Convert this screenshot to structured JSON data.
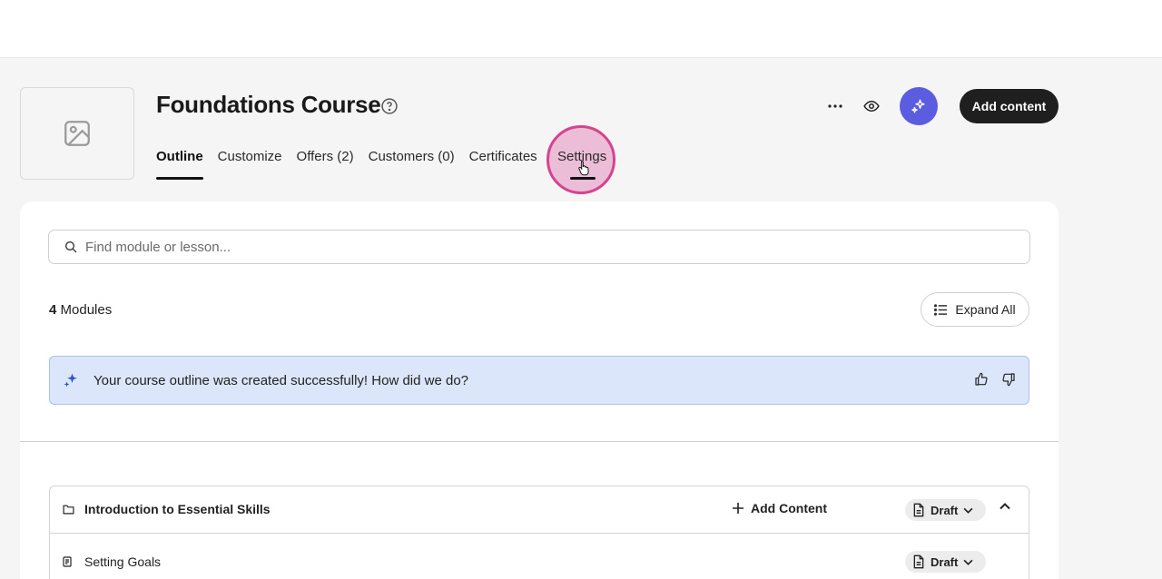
{
  "course": {
    "title": "Foundations Course"
  },
  "tabs": [
    {
      "label": "Outline",
      "active": true
    },
    {
      "label": "Customize",
      "active": false
    },
    {
      "label": "Offers (2)",
      "active": false
    },
    {
      "label": "Customers (0)",
      "active": false
    },
    {
      "label": "Certificates",
      "active": false
    },
    {
      "label": "Settings",
      "active": false
    }
  ],
  "header": {
    "add_content_label": "Add content"
  },
  "search": {
    "placeholder": "Find module or lesson..."
  },
  "modules_summary": {
    "count": "4",
    "label": "Modules"
  },
  "expand_label": "Expand All",
  "banner": {
    "text": "Your course outline was created successfully! How did we do?"
  },
  "module": {
    "title": "Introduction to Essential Skills",
    "add_content_label": "Add Content",
    "status": "Draft",
    "lessons": [
      {
        "title": "Setting Goals",
        "status": "Draft"
      }
    ]
  },
  "colors": {
    "accent": "#5b5ce0",
    "banner_bg": "#dbe6fb",
    "click_highlight": "#d6438e"
  }
}
